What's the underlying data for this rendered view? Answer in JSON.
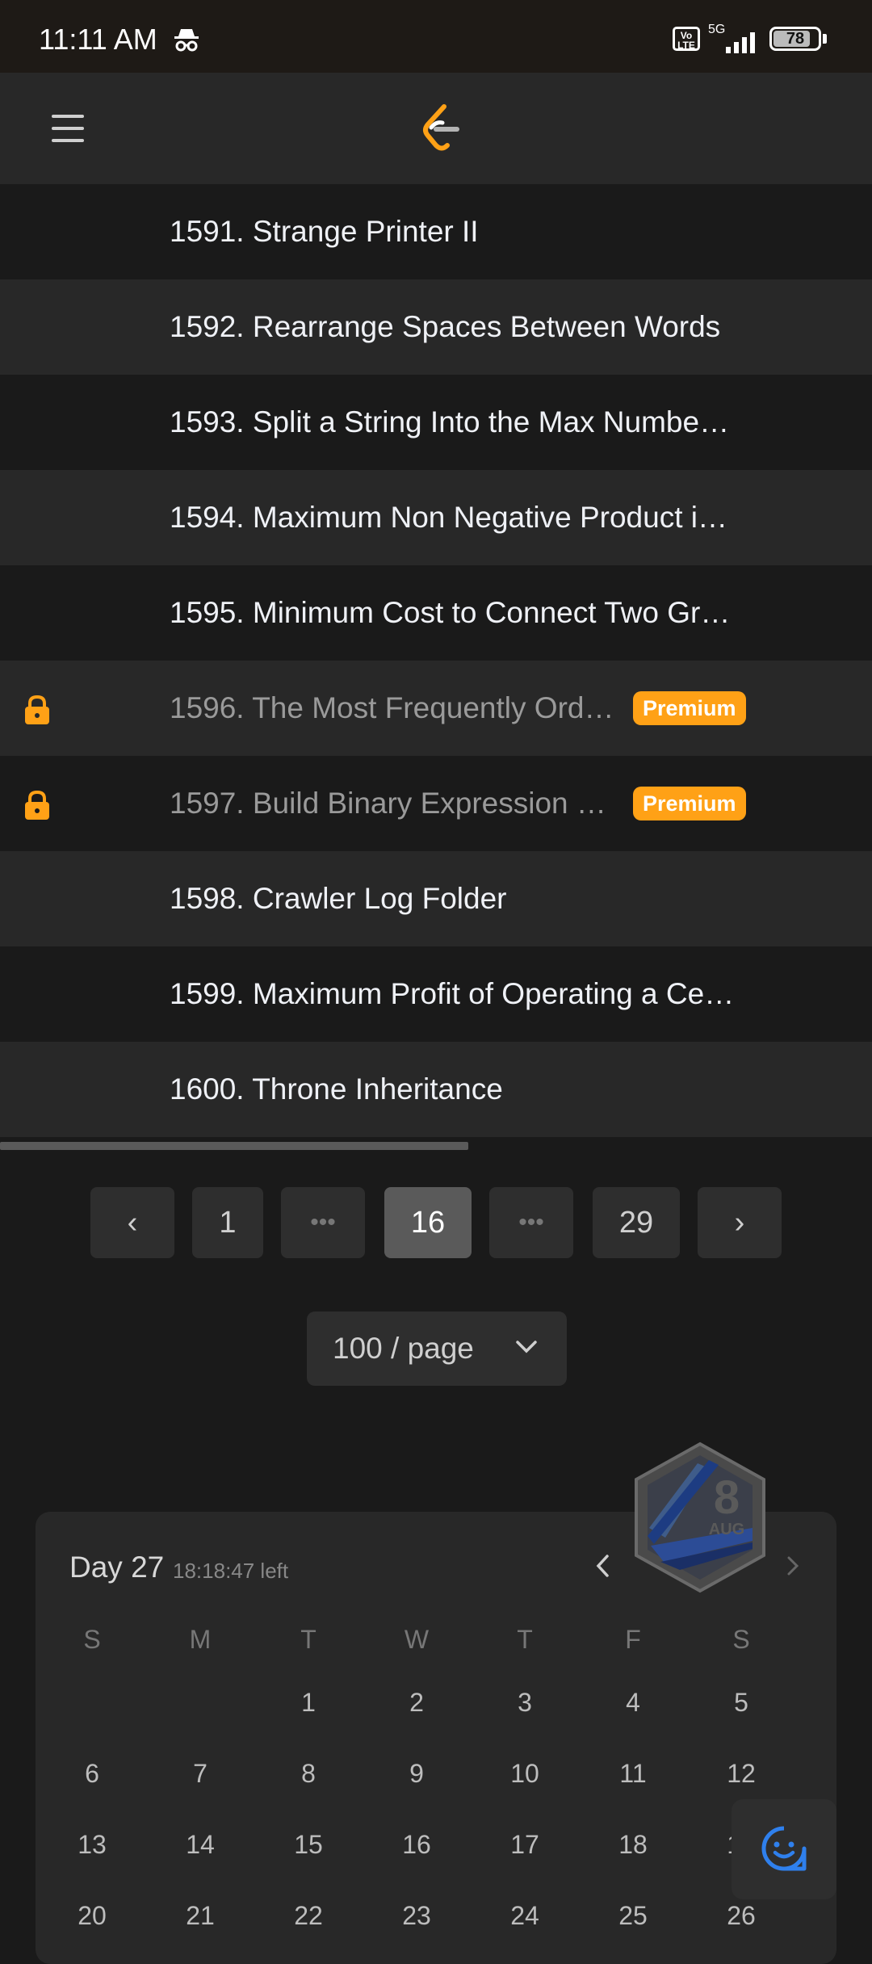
{
  "status": {
    "time": "11:11 AM",
    "network": "5G",
    "volte": "Vo LTE",
    "battery": "78"
  },
  "colors": {
    "accent": "#ffa116",
    "background": "#1a1a1a",
    "row_alt": "#282828"
  },
  "problems": [
    {
      "title": "1591. Strange Printer II",
      "locked": false
    },
    {
      "title": "1592. Rearrange Spaces Between Words",
      "locked": false
    },
    {
      "title": "1593. Split a String Into the Max Numbe…",
      "locked": false
    },
    {
      "title": "1594. Maximum Non Negative Product i…",
      "locked": false
    },
    {
      "title": "1595. Minimum Cost to Connect Two Gr…",
      "locked": false
    },
    {
      "title": "1596. The Most Frequently Ord…",
      "locked": true,
      "badge": "Premium"
    },
    {
      "title": "1597. Build Binary Expression …",
      "locked": true,
      "badge": "Premium"
    },
    {
      "title": "1598. Crawler Log Folder",
      "locked": false
    },
    {
      "title": "1599. Maximum Profit of Operating a Ce…",
      "locked": false
    },
    {
      "title": "1600. Throne Inheritance",
      "locked": false
    }
  ],
  "pagination": {
    "prev": "‹",
    "next": "›",
    "first": "1",
    "current": "16",
    "last": "29",
    "ellipsis": "•••",
    "page_size": "100 / page"
  },
  "calendar": {
    "day_label": "Day 27",
    "time_left": "18:18:47 left",
    "weekdays": [
      "S",
      "M",
      "T",
      "W",
      "T",
      "F",
      "S"
    ],
    "weeks": [
      [
        "",
        "",
        "1",
        "2",
        "3",
        "4",
        "5"
      ],
      [
        "6",
        "7",
        "8",
        "9",
        "10",
        "11",
        "12"
      ],
      [
        "13",
        "14",
        "15",
        "16",
        "17",
        "18",
        "19"
      ],
      [
        "20",
        "21",
        "22",
        "23",
        "24",
        "25",
        "26"
      ]
    ],
    "badge": {
      "day": "8",
      "month": "AUG"
    }
  },
  "icons": {
    "menu": "hamburger-icon",
    "logo": "leetcode-logo",
    "lock": "lock-icon",
    "feedback": "smiley-chat-icon"
  }
}
